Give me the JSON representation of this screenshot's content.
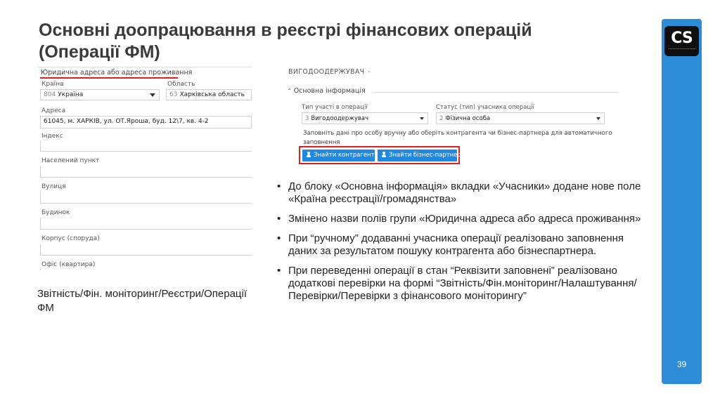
{
  "title": {
    "line1": "Основні доопрацювання в реєстрі фінансових операцій",
    "line2": "(Операції ФМ)"
  },
  "address_form": {
    "section_label": "Юридична адреса або адреса проживання",
    "country_label": "Країна",
    "country_code": "804",
    "country_value": "Україна",
    "region_label": "Область",
    "region_code": "63",
    "region_value": "Харківська область",
    "address_label": "Адреса",
    "address_value": "61045, м. ХАРКІВ, ул. ОТ.Яроша, буд. 12\\7, кв. 4-2",
    "index_label": "Індекс",
    "city_label": "Населений пункт",
    "street_label": "Вулиця",
    "building_label": "Будинок",
    "corpus_label": "Корпус (споруда)",
    "office_label": "Офіс (квартира)"
  },
  "path_text": "Звітність/Фін. моніторинг/Реєстри/Операції ФМ",
  "beneficiary_form": {
    "title": "ВИГОДООДЕРЖУВАЧ",
    "title_marker": "•",
    "section_label": "Основна інформація",
    "participation_type_label": "Тип участі в операції",
    "participation_type_code": "3",
    "participation_type_value": "Вигодоодержувач",
    "status_label": "Статус (тип) учасника операції",
    "status_code": "2",
    "status_value": "Фізична особа",
    "hint_text": "Заповніть дані про особу вручну або оберіть контрагента чи бізнес-партнера для автоматичного заповнення",
    "find_counterparty_button": "Знайти контрагента",
    "find_partner_button": "Знайти бізнес-партнера"
  },
  "bullets": [
    "До блоку «Основна інформація» вкладки «Учасники» додане нове поле «Країна реєстрації/громадянства»",
    "Змінено назви полів групи «Юридична адреса або адреса проживання»",
    "При “ручному” додаванні учасника операції реалізовано заповнення даних за результатом пошуку контрагента або бізнеспартнера.",
    "При переведенні операції в стан “Реквізити заповнені” реалізовано додаткові перевірки на формі “Звітність/Фін.моніторинг/Налаштування/ Перевірки/Перевірки з фінансового моніторингу”"
  ],
  "bullet_marker": "•",
  "logo_text": "CS",
  "page_number": "39",
  "colors": {
    "accent_blue": "#2d8cd8",
    "highlight_red": "#e0201f",
    "button_blue": "#1e88e5"
  }
}
